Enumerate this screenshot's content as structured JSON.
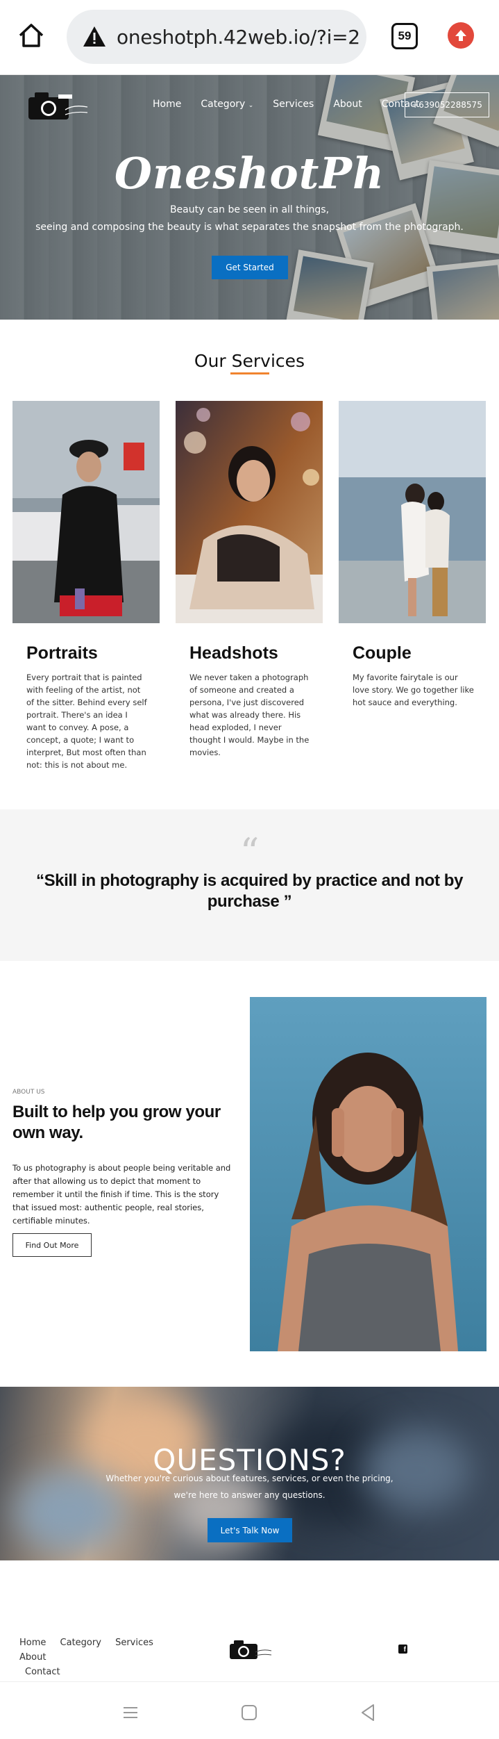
{
  "browser": {
    "url": "oneshotph.42web.io/?i=2",
    "tab_count": "59"
  },
  "nav": {
    "items": [
      "Home",
      "Category",
      "Services",
      "About",
      "Contact"
    ],
    "phone": "+639052288575"
  },
  "hero": {
    "title": "OneshotPh",
    "line1": "Beauty can be seen in all things,",
    "line2": "seeing and composing the beauty is what separates the snapshot from the photograph.",
    "cta": "Get Started"
  },
  "services": {
    "title": "Our Services",
    "items": [
      {
        "title": "Portraits",
        "text": "Every portrait that is painted with feeling of the artist, not of the sitter. Behind every self portrait. There's an idea I want to convey. A pose, a concept, a quote; I want to interpret, But most often than not: this is not about me."
      },
      {
        "title": "Headshots",
        "text": "We never taken a photograph of someone and created a persona, I've just discovered what was already there. His head exploded, I never thought I would. Maybe in the movies."
      },
      {
        "title": "Couple",
        "text": "My favorite fairytale is our love story. We go together like hot sauce and everything."
      }
    ]
  },
  "quote": {
    "mark": "“",
    "text": "“Skill in photography is acquired by practice and not by purchase ”"
  },
  "about": {
    "eyebrow": "ABOUT US",
    "title": "Built to help you grow your own way.",
    "text": "To us photography is about people being veritable and after that allowing us to depict that moment to remember it until the finish if time. This is the story that issued most: authentic people, real stories, certifiable minutes.",
    "button": "Find Out More"
  },
  "questions": {
    "title": "QUESTIONS?",
    "line1": "Whether you're curious about features, services, or even the pricing,",
    "line2": "we're here to answer any questions.",
    "button": "Let's Talk Now"
  },
  "footer": {
    "links": [
      "Home",
      "Category",
      "Services",
      "About",
      "Contact"
    ]
  },
  "colors": {
    "accent": "#0a6fc2",
    "underline": "#f0832e",
    "update": "#e2483b"
  }
}
